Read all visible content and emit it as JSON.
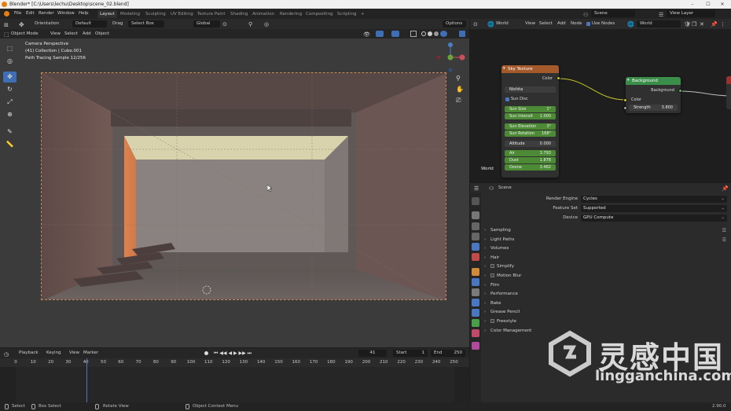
{
  "window": {
    "title": "Blender* [C:\\Users\\lechu\\Desktop\\scene_02.blend]",
    "buttons": [
      "–",
      "☐",
      "✕"
    ]
  },
  "menubar": {
    "items": [
      "File",
      "Edit",
      "Render",
      "Window",
      "Help"
    ]
  },
  "workspaces": [
    "Layout",
    "Modeling",
    "Sculpting",
    "UV Editing",
    "Texture Paint",
    "Shading",
    "Animation",
    "Rendering",
    "Compositing",
    "Scripting"
  ],
  "workspace_add": "+",
  "topbar": {
    "scene": "Scene",
    "view_layer": "View Layer"
  },
  "viewport_tool_header": {
    "orientation_label": "Orientation",
    "orientation_value": "Default",
    "drag_label": "Drag",
    "drag_value": "Select Box",
    "transform_value": "Global",
    "options": "Options"
  },
  "viewport_header": {
    "mode": "Object Mode",
    "menus": [
      "View",
      "Select",
      "Add",
      "Object"
    ]
  },
  "viewport": {
    "overlay_line1": "Camera Perspective",
    "overlay_line2": "(41) Collection | Cube.001",
    "overlay_line3": "Path Tracing Sample 12/256"
  },
  "node_editor": {
    "header_type": "World",
    "menus": [
      "View",
      "Select",
      "Add",
      "Node"
    ],
    "use_nodes_label": "Use Nodes",
    "world_field": "World",
    "corner_label": "World",
    "sky_node": {
      "title": "Sky Texture",
      "output": "Color",
      "type": "Nishita",
      "sun_disc": "Sun Disc",
      "sun_size_label": "Sun Size",
      "sun_size_value": "1°",
      "sun_intensity_label": "Sun Intensit",
      "sun_intensity_value": "1.000",
      "sun_elevation_label": "Sun Elevation",
      "sun_elevation_value": "3°",
      "sun_rotation_label": "Sun Rotation",
      "sun_rotation_value": "168°",
      "altitude_label": "Altitude",
      "altitude_value": "0.000",
      "air_label": "Air",
      "air_value": "3.793",
      "dust_label": "Dust",
      "dust_value": "1.878",
      "ozone_label": "Ozone",
      "ozone_value": "3.462"
    },
    "bg_node": {
      "title": "Background",
      "output": "Background",
      "color": "Color",
      "strength_label": "Strength",
      "strength_value": "3.800"
    }
  },
  "properties": {
    "context": "Scene",
    "render_engine_label": "Render Engine",
    "render_engine_value": "Cycles",
    "feature_set_label": "Feature Set",
    "feature_set_value": "Supported",
    "device_label": "Device",
    "device_value": "GPU Compute",
    "panels": [
      {
        "label": "Sampling",
        "checkbox": false,
        "list": true
      },
      {
        "label": "Light Paths",
        "checkbox": false,
        "list": true
      },
      {
        "label": "Volumes",
        "checkbox": false,
        "list": false
      },
      {
        "label": "Hair",
        "checkbox": false,
        "list": false
      },
      {
        "label": "Simplify",
        "checkbox": true,
        "list": false
      },
      {
        "label": "Motion Blur",
        "checkbox": true,
        "list": false
      },
      {
        "label": "Film",
        "checkbox": false,
        "list": false
      },
      {
        "label": "Performance",
        "checkbox": false,
        "list": false
      },
      {
        "label": "Bake",
        "checkbox": false,
        "list": false
      },
      {
        "label": "Grease Pencil",
        "checkbox": false,
        "list": false
      },
      {
        "label": "Freestyle",
        "checkbox": true,
        "list": false
      },
      {
        "label": "Color Management",
        "checkbox": false,
        "list": false
      }
    ]
  },
  "timeline": {
    "menus": [
      "Playback",
      "Keying",
      "View",
      "Marker"
    ],
    "current_frame": "41",
    "start_label": "Start",
    "start_value": "1",
    "end_label": "End",
    "end_value": "250",
    "ticks": [
      "0",
      "10",
      "20",
      "30",
      "40",
      "50",
      "60",
      "70",
      "80",
      "90",
      "100",
      "110",
      "120",
      "130",
      "140",
      "150",
      "160",
      "170",
      "180",
      "190",
      "200",
      "210",
      "220",
      "230",
      "240",
      "250"
    ],
    "playhead_label": "41"
  },
  "statusbar": {
    "select": "Select",
    "box_select": "Box Select",
    "rotate_view": "Rotate View",
    "context_menu": "Object Context Menu",
    "version": "2.90.0"
  },
  "watermark": {
    "cn": "灵感中国",
    "url": "lingganchina.com"
  },
  "colors": {
    "accent": "#3f6eb5",
    "node_header_sky": "#a55a2c",
    "node_header_bg": "#3b8d4a",
    "field_green": "#4c8a36",
    "socket_yellow": "#c7c729"
  }
}
